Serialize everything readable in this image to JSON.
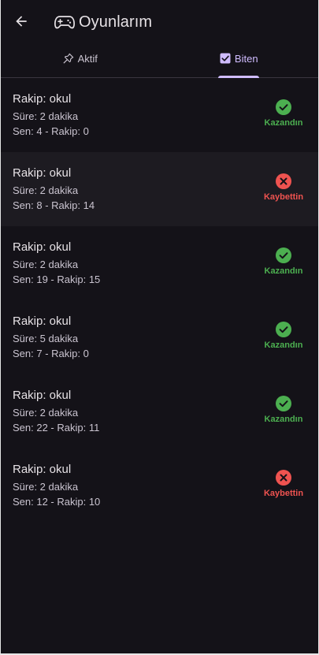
{
  "appbar": {
    "title": "Oyunlarım",
    "back_icon": "arrow-left-icon",
    "title_icon": "gamepad-icon"
  },
  "tabs": [
    {
      "label": "Aktif",
      "icon": "pin-icon",
      "selected": false
    },
    {
      "label": "Biten",
      "icon": "checkbox-icon",
      "selected": true
    }
  ],
  "colors": {
    "background": "#141218",
    "accent": "#d0bcff",
    "win": "#4caf50",
    "loss": "#ef5350"
  },
  "games": [
    {
      "opponent": "Rakip: okul",
      "duration": "Süre: 2 dakika",
      "score": "Sen: 4 - Rakip: 0",
      "result": "Kazandın",
      "won": true
    },
    {
      "opponent": "Rakip: okul",
      "duration": "Süre: 2 dakika",
      "score": "Sen: 8 - Rakip: 14",
      "result": "Kaybettin",
      "won": false
    },
    {
      "opponent": "Rakip: okul",
      "duration": "Süre: 2 dakika",
      "score": "Sen: 19 - Rakip: 15",
      "result": "Kazandın",
      "won": true
    },
    {
      "opponent": "Rakip: okul",
      "duration": "Süre: 5 dakika",
      "score": "Sen: 7 - Rakip: 0",
      "result": "Kazandın",
      "won": true
    },
    {
      "opponent": "Rakip: okul",
      "duration": "Süre: 2 dakika",
      "score": "Sen: 22 - Rakip: 11",
      "result": "Kazandın",
      "won": true
    },
    {
      "opponent": "Rakip: okul",
      "duration": "Süre: 2 dakika",
      "score": "Sen: 12 - Rakip: 10",
      "result": "Kaybettin",
      "won": false
    }
  ]
}
